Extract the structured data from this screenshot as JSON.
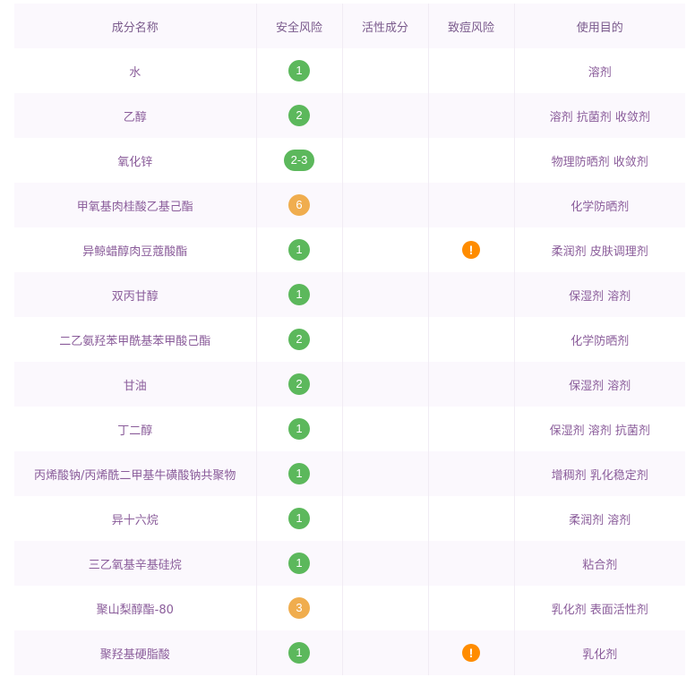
{
  "colors": {
    "safe": "#5cb85c",
    "moderate": "#f0ad4e",
    "warning": "#ff8c00"
  },
  "table": {
    "headers": [
      "成分名称",
      "安全风险",
      "活性成分",
      "致痘风险",
      "使用目的"
    ],
    "rows": [
      {
        "name": "水",
        "risk": "1",
        "risk_level": "safe",
        "active": "",
        "acne": "",
        "purpose": "溶剂"
      },
      {
        "name": "乙醇",
        "risk": "2",
        "risk_level": "safe",
        "active": "",
        "acne": "",
        "purpose": "溶剂 抗菌剂 收敛剂"
      },
      {
        "name": "氧化锌",
        "risk": "2-3",
        "risk_level": "safe",
        "active": "",
        "acne": "",
        "purpose": "物理防晒剂 收敛剂"
      },
      {
        "name": "甲氧基肉桂酸乙基己酯",
        "risk": "6",
        "risk_level": "moderate",
        "active": "",
        "acne": "",
        "purpose": "化学防晒剂"
      },
      {
        "name": "异鲸蜡醇肉豆蔻酸酯",
        "risk": "1",
        "risk_level": "safe",
        "active": "",
        "acne": "!",
        "purpose": "柔润剂 皮肤调理剂"
      },
      {
        "name": "双丙甘醇",
        "risk": "1",
        "risk_level": "safe",
        "active": "",
        "acne": "",
        "purpose": "保湿剂 溶剂"
      },
      {
        "name": "二乙氨羟苯甲酰基苯甲酸己酯",
        "risk": "2",
        "risk_level": "safe",
        "active": "",
        "acne": "",
        "purpose": "化学防晒剂"
      },
      {
        "name": "甘油",
        "risk": "2",
        "risk_level": "safe",
        "active": "",
        "acne": "",
        "purpose": "保湿剂 溶剂"
      },
      {
        "name": "丁二醇",
        "risk": "1",
        "risk_level": "safe",
        "active": "",
        "acne": "",
        "purpose": "保湿剂 溶剂 抗菌剂"
      },
      {
        "name": "丙烯酸钠/丙烯酰二甲基牛磺酸钠共聚物",
        "risk": "1",
        "risk_level": "safe",
        "active": "",
        "acne": "",
        "purpose": "增稠剂 乳化稳定剂"
      },
      {
        "name": "异十六烷",
        "risk": "1",
        "risk_level": "safe",
        "active": "",
        "acne": "",
        "purpose": "柔润剂 溶剂"
      },
      {
        "name": "三乙氧基辛基硅烷",
        "risk": "1",
        "risk_level": "safe",
        "active": "",
        "acne": "",
        "purpose": "粘合剂"
      },
      {
        "name": "聚山梨醇酯-80",
        "risk": "3",
        "risk_level": "moderate",
        "active": "",
        "acne": "",
        "purpose": "乳化剂 表面活性剂"
      },
      {
        "name": "聚羟基硬脂酸",
        "risk": "1",
        "risk_level": "safe",
        "active": "",
        "acne": "!",
        "purpose": "乳化剂"
      }
    ]
  }
}
